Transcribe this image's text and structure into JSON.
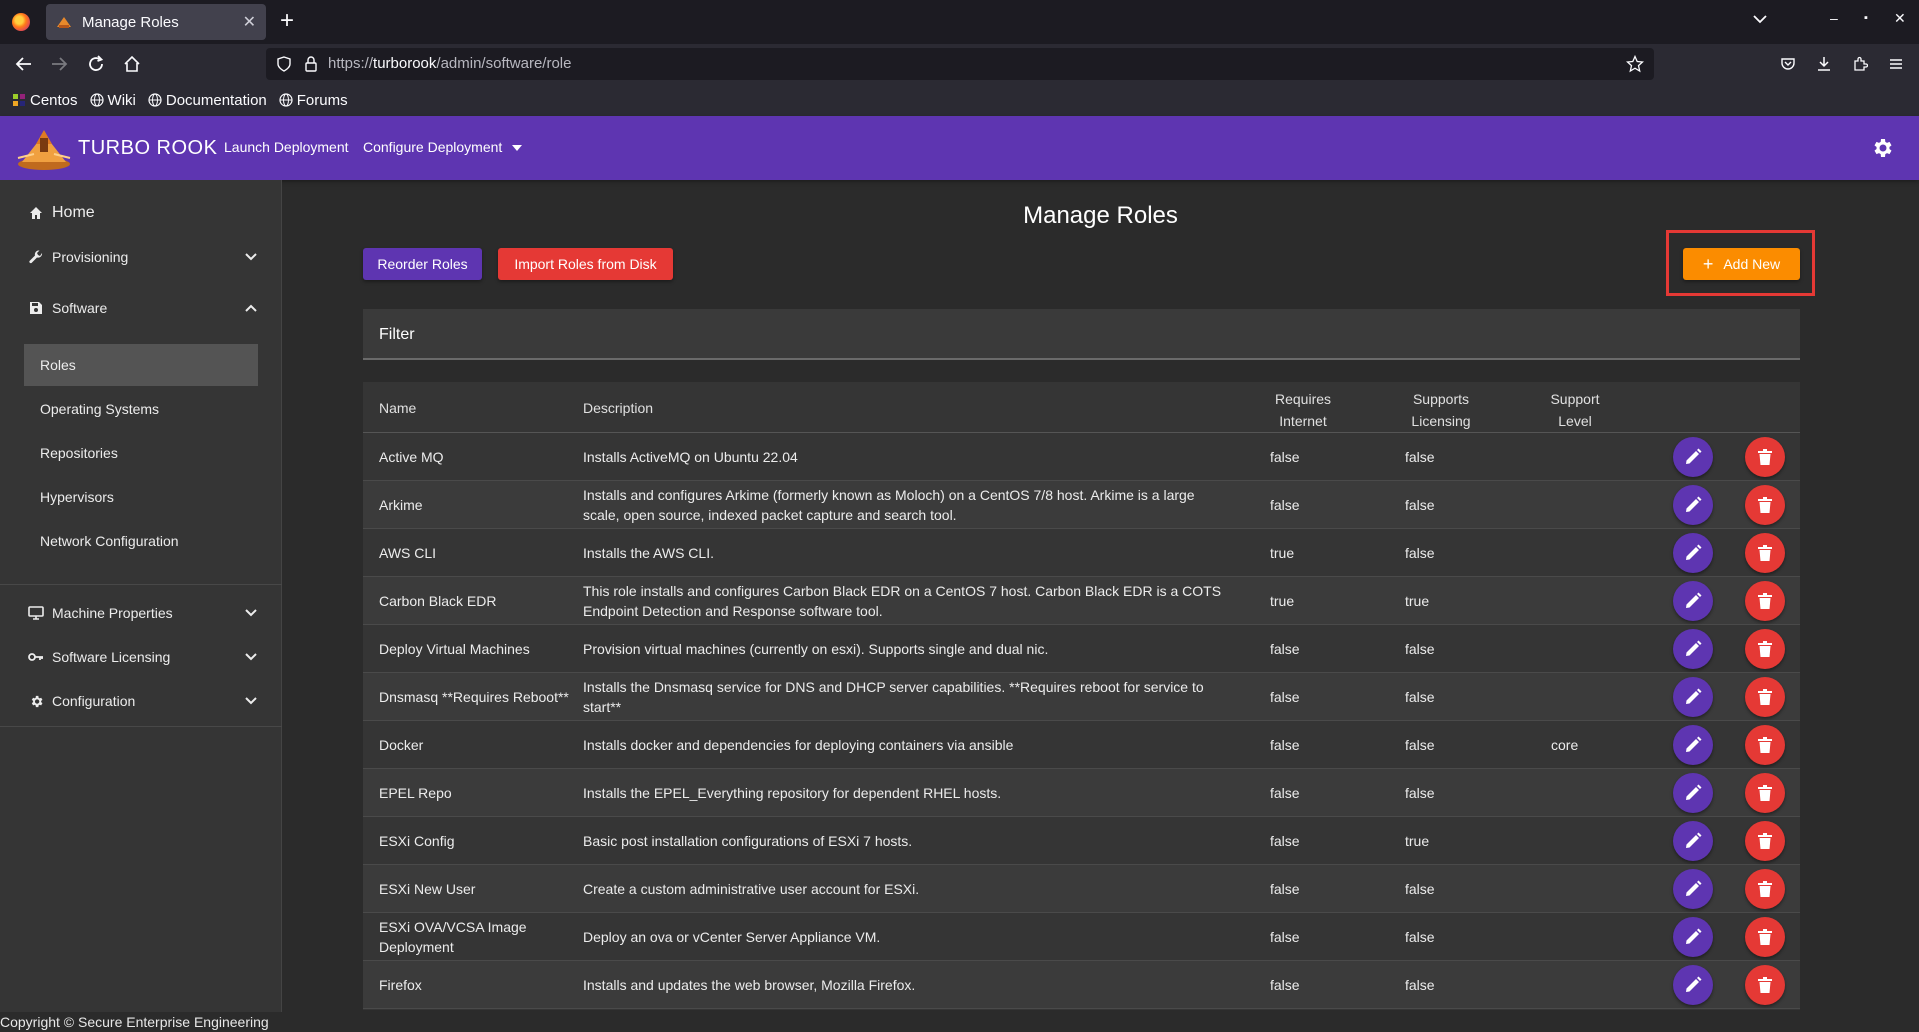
{
  "browser": {
    "tab_title": "Manage Roles",
    "url_prefix": "https://",
    "url_host": "turborook",
    "url_path": "/admin/software/role",
    "bookmarks": [
      "Centos",
      "Wiki",
      "Documentation",
      "Forums"
    ]
  },
  "header": {
    "brand": "TURBO ROOK",
    "nav": [
      "Launch Deployment",
      "Configure Deployment"
    ],
    "colors": {
      "primary": "#5e35b1",
      "danger": "#e53935",
      "accent": "#fb8c00"
    }
  },
  "sidebar": {
    "home": "Home",
    "provisioning": "Provisioning",
    "software": "Software",
    "software_items": [
      "Roles",
      "Operating Systems",
      "Repositories",
      "Hypervisors",
      "Network Configuration"
    ],
    "machine_properties": "Machine Properties",
    "software_licensing": "Software Licensing",
    "configuration": "Configuration"
  },
  "footer": "Copyright © Secure Enterprise Engineering",
  "main": {
    "title": "Manage Roles",
    "reorder_label": "Reorder Roles",
    "import_label": "Import Roles from Disk",
    "add_new_label": "Add New",
    "filter_label": "Filter",
    "columns": {
      "name": "Name",
      "description": "Description",
      "requires_internet": "Requires Internet",
      "supports_licensing": "Supports Licensing",
      "support_level": "Support Level"
    },
    "rows": [
      {
        "name": "Active MQ",
        "description": "Installs ActiveMQ on Ubuntu 22.04",
        "internet": "false",
        "licensing": "false",
        "support": ""
      },
      {
        "name": "Arkime",
        "description": "Installs and configures Arkime (formerly known as Moloch) on a CentOS 7/8 host. Arkime is a large scale, open source, indexed packet capture and search tool.",
        "internet": "false",
        "licensing": "false",
        "support": ""
      },
      {
        "name": "AWS CLI",
        "description": "Installs the AWS CLI.",
        "internet": "true",
        "licensing": "false",
        "support": ""
      },
      {
        "name": "Carbon Black EDR",
        "description": "This role installs and configures Carbon Black EDR on a CentOS 7 host. Carbon Black EDR is a COTS Endpoint Detection and Response software tool.",
        "internet": "true",
        "licensing": "true",
        "support": ""
      },
      {
        "name": "Deploy Virtual Machines",
        "description": "Provision virtual machines (currently on esxi). Supports single and dual nic.",
        "internet": "false",
        "licensing": "false",
        "support": ""
      },
      {
        "name": "Dnsmasq **Requires Reboot**",
        "description": "Installs the Dnsmasq service for DNS and DHCP server capabilities. **Requires reboot for service to start**",
        "internet": "false",
        "licensing": "false",
        "support": ""
      },
      {
        "name": "Docker",
        "description": "Installs docker and dependencies for deploying containers via ansible",
        "internet": "false",
        "licensing": "false",
        "support": "core"
      },
      {
        "name": "EPEL Repo",
        "description": "Installs the EPEL_Everything repository for dependent RHEL hosts.",
        "internet": "false",
        "licensing": "false",
        "support": ""
      },
      {
        "name": "ESXi Config",
        "description": "Basic post installation configurations of ESXi 7 hosts.",
        "internet": "false",
        "licensing": "true",
        "support": ""
      },
      {
        "name": "ESXi New User",
        "description": "Create a custom administrative user account for ESXi.",
        "internet": "false",
        "licensing": "false",
        "support": ""
      },
      {
        "name": "ESXi OVA/VCSA Image Deployment",
        "description": "Deploy an ova or vCenter Server Appliance VM.",
        "internet": "false",
        "licensing": "false",
        "support": ""
      },
      {
        "name": "Firefox",
        "description": "Installs and updates the web browser, Mozilla Firefox.",
        "internet": "false",
        "licensing": "false",
        "support": ""
      }
    ]
  }
}
